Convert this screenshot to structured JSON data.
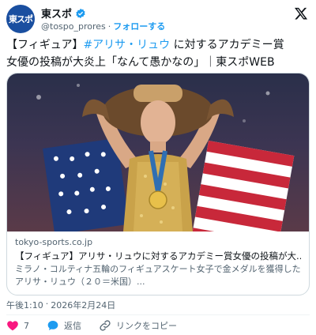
{
  "account": {
    "avatar_text": "東スポ",
    "display_name": "東スポ",
    "handle": "@tospo_prores",
    "separator": "·",
    "follow_label": "フォローする"
  },
  "tweet": {
    "text_prefix": "【フィギュア】",
    "hashtag": "#アリサ・リュウ",
    "text_line1_rest": " に対するアカデミー賞",
    "text_line2": "女優の投稿が大炎上「なんて愚かなの」｜東スポWEB"
  },
  "card": {
    "domain": "tokyo-sports.co.jp",
    "title": "【フィギュア】アリサ・リュウに対するアカデミー賞女優の投稿が大...",
    "description": "ミラノ・コルティナ五輪のフィギュアスケート女子で金メダルを獲得したアリサ・リュウ（２０＝米国）..."
  },
  "meta": {
    "time": "午後1:10",
    "separator": "·",
    "date": "2026年2月24日"
  },
  "actions": {
    "like_count": "7",
    "reply_label": "返信",
    "copy_link_label": "リンクをコピー"
  },
  "colors": {
    "accent": "#1d9bf0",
    "like": "#f91880",
    "brand": "#1a4fa0"
  }
}
